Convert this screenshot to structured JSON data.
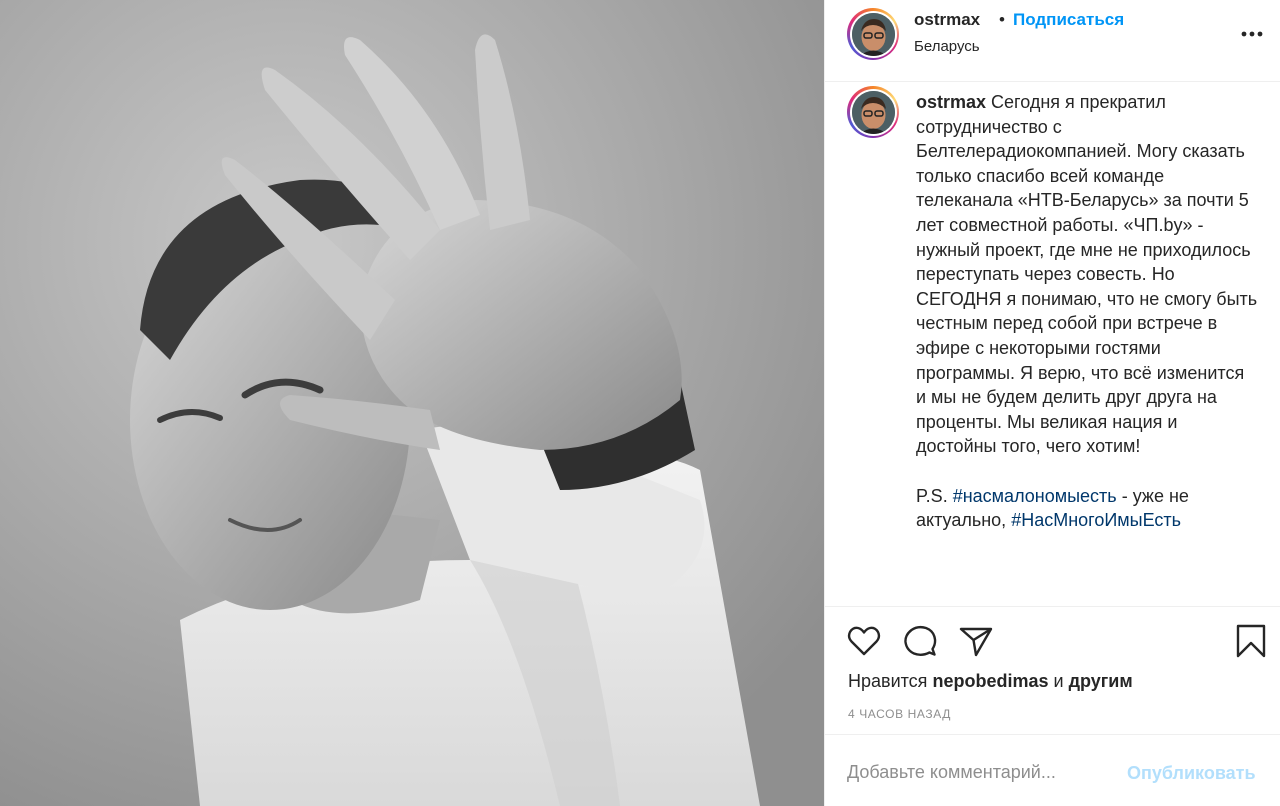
{
  "post": {
    "photo": {
      "alt": ""
    },
    "header": {
      "username": "ostrmax",
      "separator": "•",
      "follow_label": "Подписаться",
      "location": "Беларусь",
      "more_icon": "more-horizontal-icon"
    },
    "caption": {
      "username": "ostrmax",
      "paragraph_1": "Сегодня я прекратил сотрудничество с Белтелерадиокомпанией. Могу сказать только спасибо всей команде телеканала «НТВ-Беларусь» за почти 5 лет совместной работы. «ЧП.by» - нужный проект, где мне не приходилось переступать через совесть. Но СЕГОДНЯ я понимаю, что не смогу быть честным перед собой при встрече в эфире с некоторыми гостями программы. Я верю, что всё изменится и мы не будем делить друг друга на проценты. Мы великая нация и достойны того, чего хотим!",
      "ps_prefix": "P.S.",
      "hashtag_1": "#насмалономыесть",
      "ps_middle": "- уже не актуально,",
      "hashtag_2": "#НасМногоИмыЕсть"
    },
    "actions": {
      "like_icon": "heart-icon",
      "comment_icon": "comment-icon",
      "share_icon": "paper-plane-icon",
      "save_icon": "bookmark-icon"
    },
    "likes": {
      "prefix": "Нравится",
      "user": "nepobedimas",
      "conjunction": "и",
      "others": "другим"
    },
    "timestamp": "4 часов назад",
    "comment": {
      "placeholder": "Добавьте комментарий...",
      "value": "",
      "publish_label": "Опубликовать"
    },
    "colors": {
      "link_blue": "#0095f6",
      "hashtag": "#00376b",
      "text": "#262626",
      "muted": "#8e8e8e",
      "publish_disabled": "#b2dffc",
      "divider": "#efefef"
    }
  }
}
